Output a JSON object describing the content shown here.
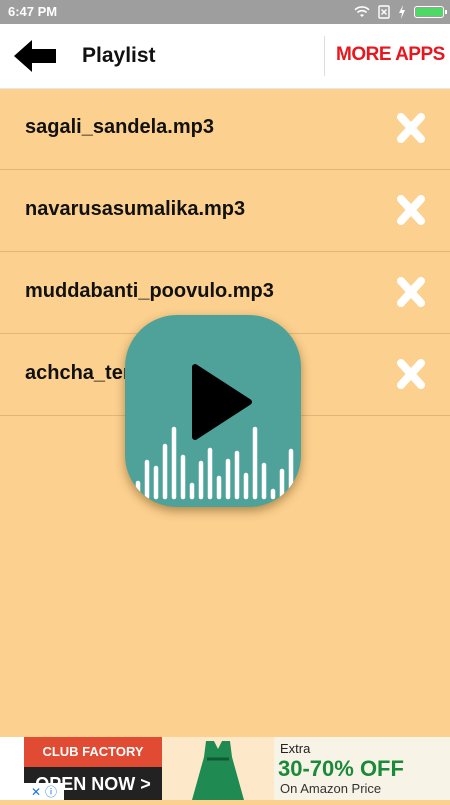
{
  "status_bar": {
    "time": "6:47 PM",
    "battery_level": 1.0
  },
  "header": {
    "title": "Playlist",
    "more_label": "MORE APPS"
  },
  "playlist": [
    {
      "name": "sagali_sandela.mp3"
    },
    {
      "name": "navarusasumalika.mp3"
    },
    {
      "name": "muddabanti_poovulo.mp3"
    },
    {
      "name": "achcha_tengula.mp3"
    }
  ],
  "ad": {
    "brand": "CLUB FACTORY",
    "cta": "OPEN NOW >",
    "line1": "Extra",
    "offer": "30-70% OFF",
    "line3": "On Amazon Price"
  },
  "colors": {
    "background": "#FCD08E",
    "accent": "#e8171f",
    "player": "#4fa29a"
  }
}
